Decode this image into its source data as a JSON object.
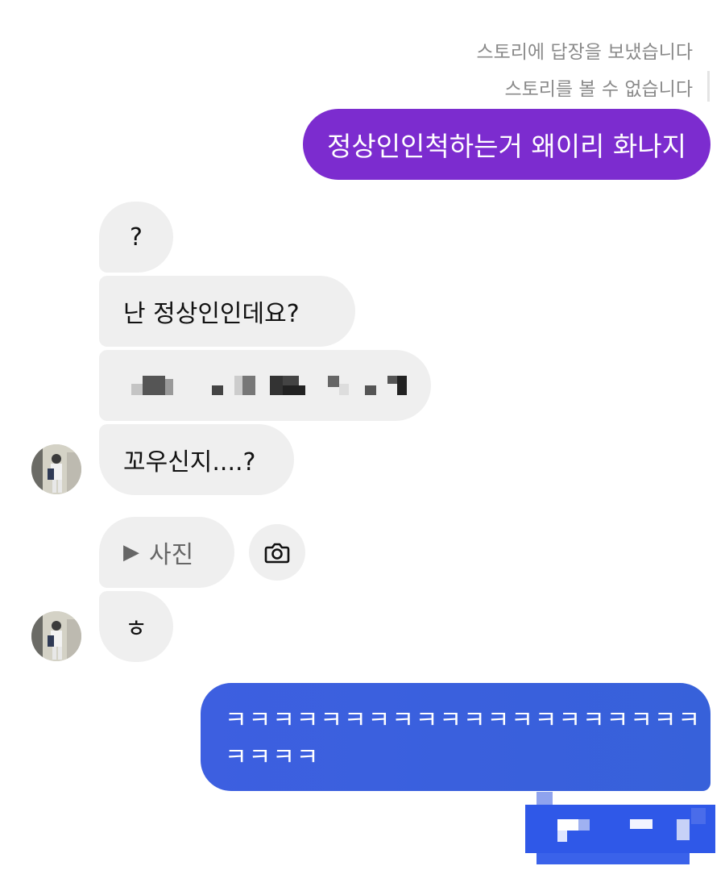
{
  "system": {
    "story_reply": "스토리에 답장을 보냈습니다",
    "story_unavailable": "스토리를 볼 수 없습니다"
  },
  "messages": {
    "sent_1": "정상인인척하는거 왜이리 화나지",
    "recv_1": "?",
    "recv_2": "난 정상인인데요?",
    "recv_4": "꼬우신지....?",
    "recv_photo_label": "사진",
    "recv_5": "ㅎ",
    "sent_2_line1": "ㅋㅋㅋㅋㅋㅋㅋㅋㅋㅋㅋㅋㅋㅋㅋㅋㅋㅋㅋㅋ",
    "sent_2_line2": "ㅋㅋㅋㅋ"
  },
  "icons": {
    "play": "play-icon",
    "camera": "camera-icon",
    "avatar": "avatar"
  },
  "colors": {
    "sent_purple": "#7c2ccf",
    "sent_blue": "#3d5fe0",
    "received_bg": "#efefef",
    "meta_text": "#8a8a8a"
  }
}
